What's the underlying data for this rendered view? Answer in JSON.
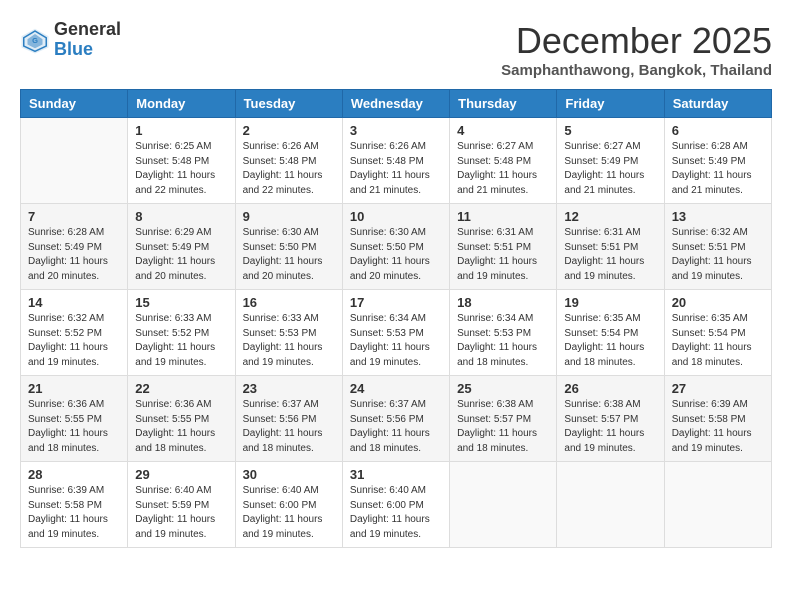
{
  "header": {
    "logo_general": "General",
    "logo_blue": "Blue",
    "month_title": "December 2025",
    "location": "Samphanthawong, Bangkok, Thailand"
  },
  "days_of_week": [
    "Sunday",
    "Monday",
    "Tuesday",
    "Wednesday",
    "Thursday",
    "Friday",
    "Saturday"
  ],
  "weeks": [
    [
      {
        "day": "",
        "info": ""
      },
      {
        "day": "1",
        "info": "Sunrise: 6:25 AM\nSunset: 5:48 PM\nDaylight: 11 hours\nand 22 minutes."
      },
      {
        "day": "2",
        "info": "Sunrise: 6:26 AM\nSunset: 5:48 PM\nDaylight: 11 hours\nand 22 minutes."
      },
      {
        "day": "3",
        "info": "Sunrise: 6:26 AM\nSunset: 5:48 PM\nDaylight: 11 hours\nand 21 minutes."
      },
      {
        "day": "4",
        "info": "Sunrise: 6:27 AM\nSunset: 5:48 PM\nDaylight: 11 hours\nand 21 minutes."
      },
      {
        "day": "5",
        "info": "Sunrise: 6:27 AM\nSunset: 5:49 PM\nDaylight: 11 hours\nand 21 minutes."
      },
      {
        "day": "6",
        "info": "Sunrise: 6:28 AM\nSunset: 5:49 PM\nDaylight: 11 hours\nand 21 minutes."
      }
    ],
    [
      {
        "day": "7",
        "info": "Sunrise: 6:28 AM\nSunset: 5:49 PM\nDaylight: 11 hours\nand 20 minutes."
      },
      {
        "day": "8",
        "info": "Sunrise: 6:29 AM\nSunset: 5:49 PM\nDaylight: 11 hours\nand 20 minutes."
      },
      {
        "day": "9",
        "info": "Sunrise: 6:30 AM\nSunset: 5:50 PM\nDaylight: 11 hours\nand 20 minutes."
      },
      {
        "day": "10",
        "info": "Sunrise: 6:30 AM\nSunset: 5:50 PM\nDaylight: 11 hours\nand 20 minutes."
      },
      {
        "day": "11",
        "info": "Sunrise: 6:31 AM\nSunset: 5:51 PM\nDaylight: 11 hours\nand 19 minutes."
      },
      {
        "day": "12",
        "info": "Sunrise: 6:31 AM\nSunset: 5:51 PM\nDaylight: 11 hours\nand 19 minutes."
      },
      {
        "day": "13",
        "info": "Sunrise: 6:32 AM\nSunset: 5:51 PM\nDaylight: 11 hours\nand 19 minutes."
      }
    ],
    [
      {
        "day": "14",
        "info": "Sunrise: 6:32 AM\nSunset: 5:52 PM\nDaylight: 11 hours\nand 19 minutes."
      },
      {
        "day": "15",
        "info": "Sunrise: 6:33 AM\nSunset: 5:52 PM\nDaylight: 11 hours\nand 19 minutes."
      },
      {
        "day": "16",
        "info": "Sunrise: 6:33 AM\nSunset: 5:53 PM\nDaylight: 11 hours\nand 19 minutes."
      },
      {
        "day": "17",
        "info": "Sunrise: 6:34 AM\nSunset: 5:53 PM\nDaylight: 11 hours\nand 19 minutes."
      },
      {
        "day": "18",
        "info": "Sunrise: 6:34 AM\nSunset: 5:53 PM\nDaylight: 11 hours\nand 18 minutes."
      },
      {
        "day": "19",
        "info": "Sunrise: 6:35 AM\nSunset: 5:54 PM\nDaylight: 11 hours\nand 18 minutes."
      },
      {
        "day": "20",
        "info": "Sunrise: 6:35 AM\nSunset: 5:54 PM\nDaylight: 11 hours\nand 18 minutes."
      }
    ],
    [
      {
        "day": "21",
        "info": "Sunrise: 6:36 AM\nSunset: 5:55 PM\nDaylight: 11 hours\nand 18 minutes."
      },
      {
        "day": "22",
        "info": "Sunrise: 6:36 AM\nSunset: 5:55 PM\nDaylight: 11 hours\nand 18 minutes."
      },
      {
        "day": "23",
        "info": "Sunrise: 6:37 AM\nSunset: 5:56 PM\nDaylight: 11 hours\nand 18 minutes."
      },
      {
        "day": "24",
        "info": "Sunrise: 6:37 AM\nSunset: 5:56 PM\nDaylight: 11 hours\nand 18 minutes."
      },
      {
        "day": "25",
        "info": "Sunrise: 6:38 AM\nSunset: 5:57 PM\nDaylight: 11 hours\nand 18 minutes."
      },
      {
        "day": "26",
        "info": "Sunrise: 6:38 AM\nSunset: 5:57 PM\nDaylight: 11 hours\nand 19 minutes."
      },
      {
        "day": "27",
        "info": "Sunrise: 6:39 AM\nSunset: 5:58 PM\nDaylight: 11 hours\nand 19 minutes."
      }
    ],
    [
      {
        "day": "28",
        "info": "Sunrise: 6:39 AM\nSunset: 5:58 PM\nDaylight: 11 hours\nand 19 minutes."
      },
      {
        "day": "29",
        "info": "Sunrise: 6:40 AM\nSunset: 5:59 PM\nDaylight: 11 hours\nand 19 minutes."
      },
      {
        "day": "30",
        "info": "Sunrise: 6:40 AM\nSunset: 6:00 PM\nDaylight: 11 hours\nand 19 minutes."
      },
      {
        "day": "31",
        "info": "Sunrise: 6:40 AM\nSunset: 6:00 PM\nDaylight: 11 hours\nand 19 minutes."
      },
      {
        "day": "",
        "info": ""
      },
      {
        "day": "",
        "info": ""
      },
      {
        "day": "",
        "info": ""
      }
    ]
  ]
}
